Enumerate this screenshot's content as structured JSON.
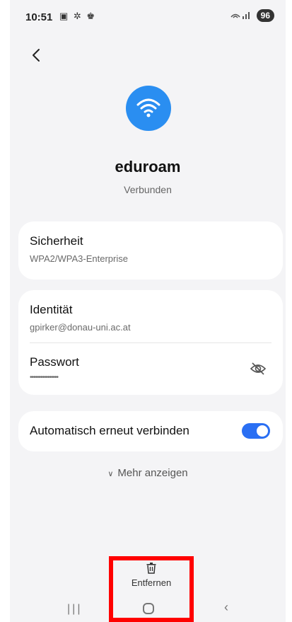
{
  "status_bar": {
    "time": "10:51",
    "left_icons": "▣ ✲ ♚",
    "battery": "96"
  },
  "network": {
    "name": "eduroam",
    "status": "Verbunden"
  },
  "security": {
    "title": "Sicherheit",
    "value": "WPA2/WPA3-Enterprise"
  },
  "identity": {
    "title": "Identität",
    "value": "gpirker@donau-uni.ac.at"
  },
  "password": {
    "title": "Passwort",
    "value": "••••••••••••••••"
  },
  "auto_reconnect": {
    "label": "Automatisch erneut verbinden",
    "enabled": true
  },
  "more": {
    "label": "Mehr anzeigen"
  },
  "remove": {
    "label": "Entfernen"
  },
  "nav": {
    "recents_glyph": "|||",
    "back_glyph": "‹"
  },
  "colors": {
    "accent": "#2a6ff3",
    "wifi_blue": "#2a8ef1",
    "highlight": "#ff0000"
  }
}
